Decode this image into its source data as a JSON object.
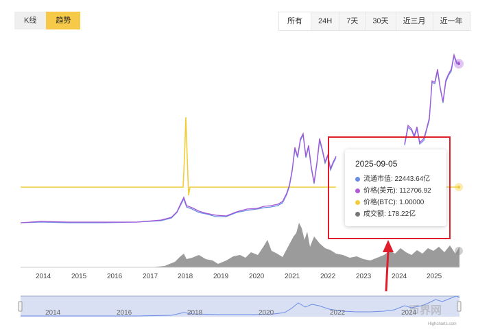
{
  "view_toggle": {
    "kline_label": "K线",
    "trend_label": "趋势"
  },
  "ranges": [
    {
      "label": "所有"
    },
    {
      "label": "24H"
    },
    {
      "label": "7天"
    },
    {
      "label": "30天"
    },
    {
      "label": "近三月"
    },
    {
      "label": "近一年"
    }
  ],
  "tooltip": {
    "date": "2025-09-05",
    "rows": [
      {
        "color": "#6b8de6",
        "text": "流通市值: 22443.64亿"
      },
      {
        "color": "#b15ad8",
        "text": "价格(美元): 112706.92"
      },
      {
        "color": "#f2cd3a",
        "text": "价格(BTC): 1.00000"
      },
      {
        "color": "#777777",
        "text": "成交额: 178.22亿"
      }
    ]
  },
  "colors": {
    "market_cap": "#6b8de6",
    "price_usd": "#a358d6",
    "price_btc": "#f2cd3a",
    "volume": "#888888",
    "annotation": "#e01e2b",
    "navigator": "#ccd6ef"
  },
  "chart_data": {
    "type": "line",
    "x": [
      "2014",
      "2015",
      "2016",
      "2017",
      "2018",
      "2019",
      "2020",
      "2021",
      "2022",
      "2023",
      "2024",
      "2025"
    ],
    "series": [
      {
        "name": "流通市值"
      },
      {
        "name": "价格(美元)"
      },
      {
        "name": "价格(BTC)"
      },
      {
        "name": "成交额"
      }
    ],
    "navigator_labels": [
      "2014",
      "2016",
      "2018",
      "2020",
      "2022",
      "2024"
    ]
  },
  "credit": "Highcharts.com",
  "watermark": "币界网"
}
